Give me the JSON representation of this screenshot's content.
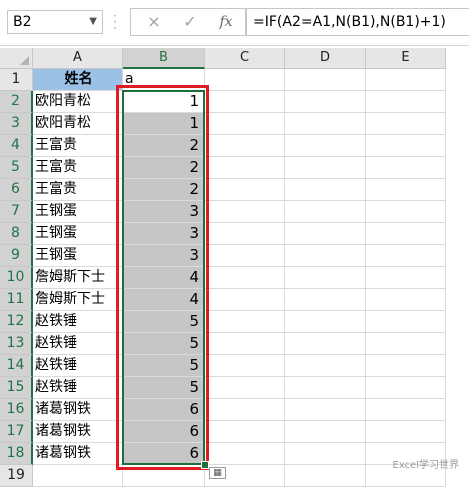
{
  "formula_bar": {
    "name_box": "B2",
    "cancel_icon": "×",
    "enter_icon": "✓",
    "fx_label": "fx",
    "formula": "=IF(A2=A1,N(B1),N(B1)+1)"
  },
  "columns": [
    "A",
    "B",
    "C",
    "D",
    "E"
  ],
  "selected_column": "B",
  "rows": [
    {
      "row": "1",
      "a": "姓名",
      "b": "a"
    },
    {
      "row": "2",
      "a": "欧阳青松",
      "b": "1"
    },
    {
      "row": "3",
      "a": "欧阳青松",
      "b": "1"
    },
    {
      "row": "4",
      "a": "王富贵",
      "b": "2"
    },
    {
      "row": "5",
      "a": "王富贵",
      "b": "2"
    },
    {
      "row": "6",
      "a": "王富贵",
      "b": "2"
    },
    {
      "row": "7",
      "a": "王钢蛋",
      "b": "3"
    },
    {
      "row": "8",
      "a": "王钢蛋",
      "b": "3"
    },
    {
      "row": "9",
      "a": "王钢蛋",
      "b": "3"
    },
    {
      "row": "10",
      "a": "詹姆斯下士",
      "b": "4"
    },
    {
      "row": "11",
      "a": "詹姆斯下士",
      "b": "4"
    },
    {
      "row": "12",
      "a": "赵铁锤",
      "b": "5"
    },
    {
      "row": "13",
      "a": "赵铁锤",
      "b": "5"
    },
    {
      "row": "14",
      "a": "赵铁锤",
      "b": "5"
    },
    {
      "row": "15",
      "a": "赵铁锤",
      "b": "5"
    },
    {
      "row": "16",
      "a": "诸葛钢铁",
      "b": "6"
    },
    {
      "row": "17",
      "a": "诸葛钢铁",
      "b": "6"
    },
    {
      "row": "18",
      "a": "诸葛钢铁",
      "b": "6"
    },
    {
      "row": "19",
      "a": "",
      "b": ""
    }
  ],
  "watermark": "Excel学习世界",
  "colors": {
    "header_fill": "#9bc2e6",
    "selection_fill": "#c6c6c6",
    "selection_border": "#1f6f3d",
    "highlight_box": "#e11b22"
  }
}
